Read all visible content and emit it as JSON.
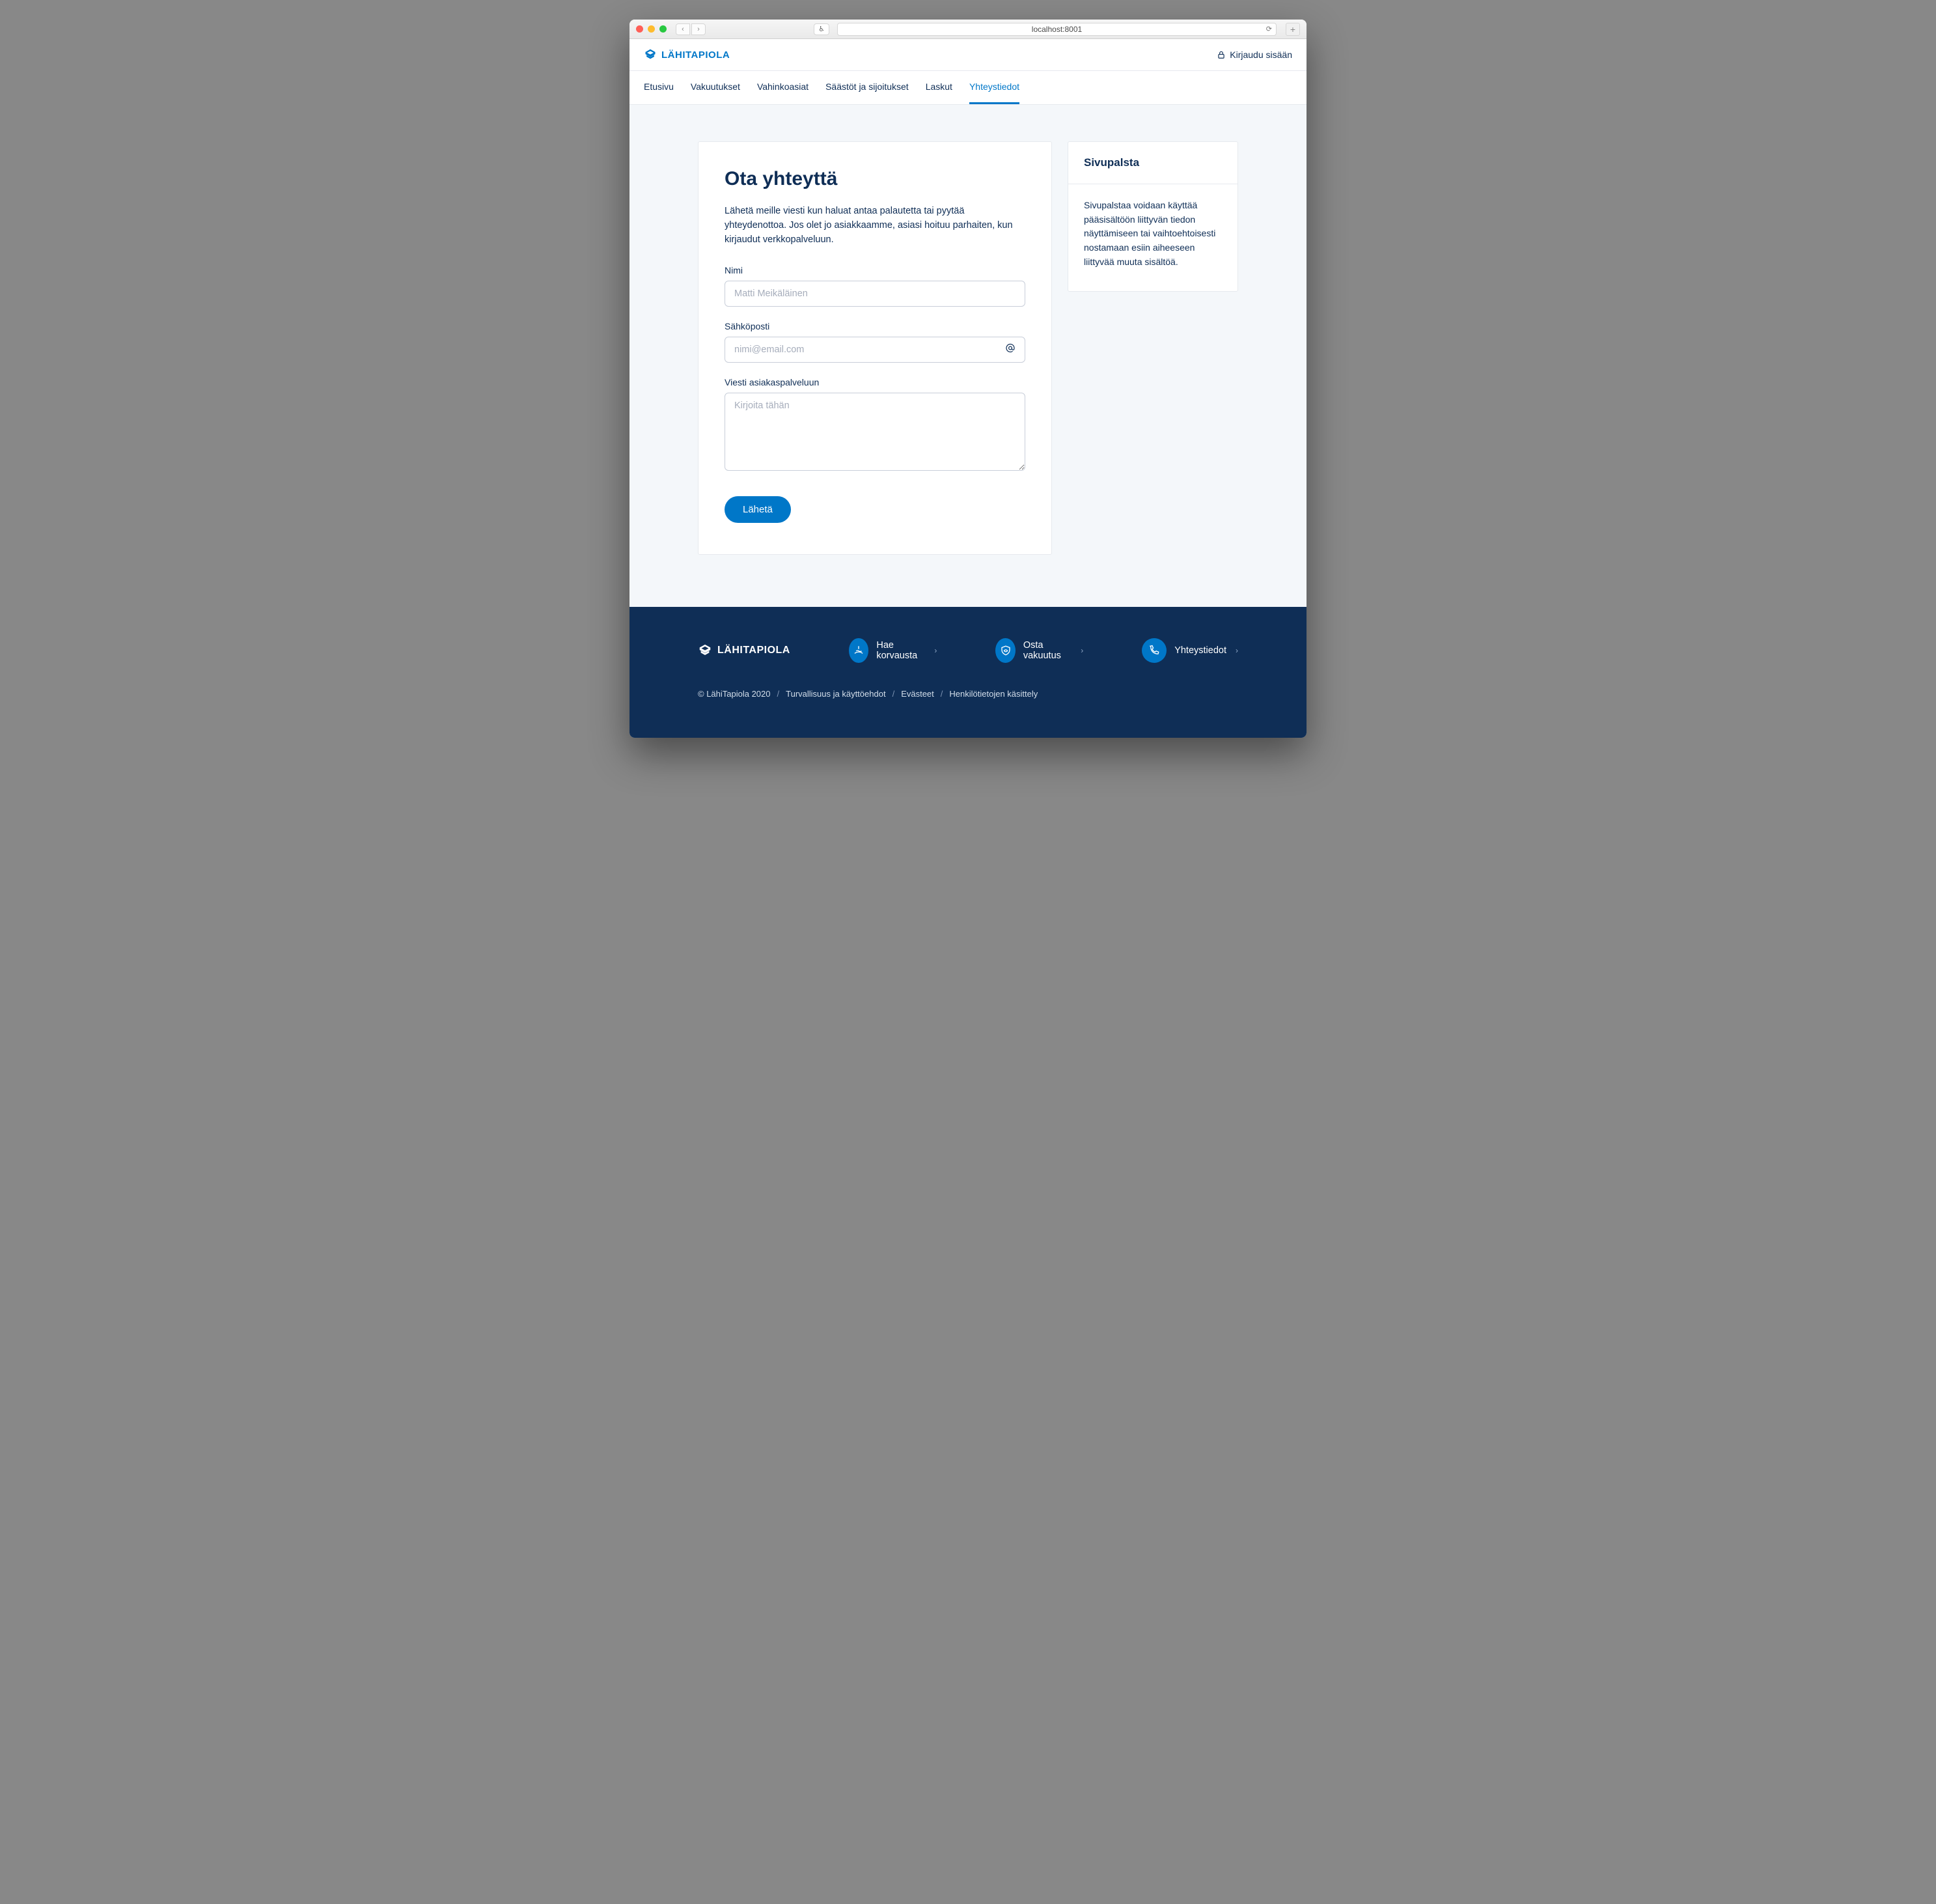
{
  "browser": {
    "url": "localhost:8001"
  },
  "header": {
    "brand": "LÄHITAPIOLA",
    "login": "Kirjaudu sisään"
  },
  "nav": {
    "items": [
      "Etusivu",
      "Vakuutukset",
      "Vahinkoasiat",
      "Säästöt ja sijoitukset",
      "Laskut",
      "Yhteystiedot"
    ],
    "active_index": 5
  },
  "main": {
    "title": "Ota yhteyttä",
    "intro": "Lähetä meille viesti kun haluat antaa palautetta tai pyytää yhteydenottoa. Jos olet jo asiakkaamme, asiasi hoituu parhaiten, kun kirjaudut verkkopalveluun.",
    "name_label": "Nimi",
    "name_placeholder": "Matti Meikäläinen",
    "email_label": "Sähköposti",
    "email_placeholder": "nimi@email.com",
    "message_label": "Viesti asiakaspalveluun",
    "message_placeholder": "Kirjoita tähän",
    "submit": "Lähetä"
  },
  "sidebar": {
    "title": "Sivupalsta",
    "body": "Sivupalstaa voidaan käyttää pääsisältöön liittyvän tiedon näyttämiseen tai vaihtoehtoisesti nostamaan esiin aiheeseen liittyvää muuta sisältöä."
  },
  "footer": {
    "brand": "LÄHITAPIOLA",
    "quick": [
      "Hae korvausta",
      "Osta vakuutus",
      "Yhteystiedot"
    ],
    "copyright": "© LähiTapiola 2020",
    "links": [
      "Turvallisuus ja käyttöehdot",
      "Evästeet",
      "Henkilötietojen käsittely"
    ]
  }
}
